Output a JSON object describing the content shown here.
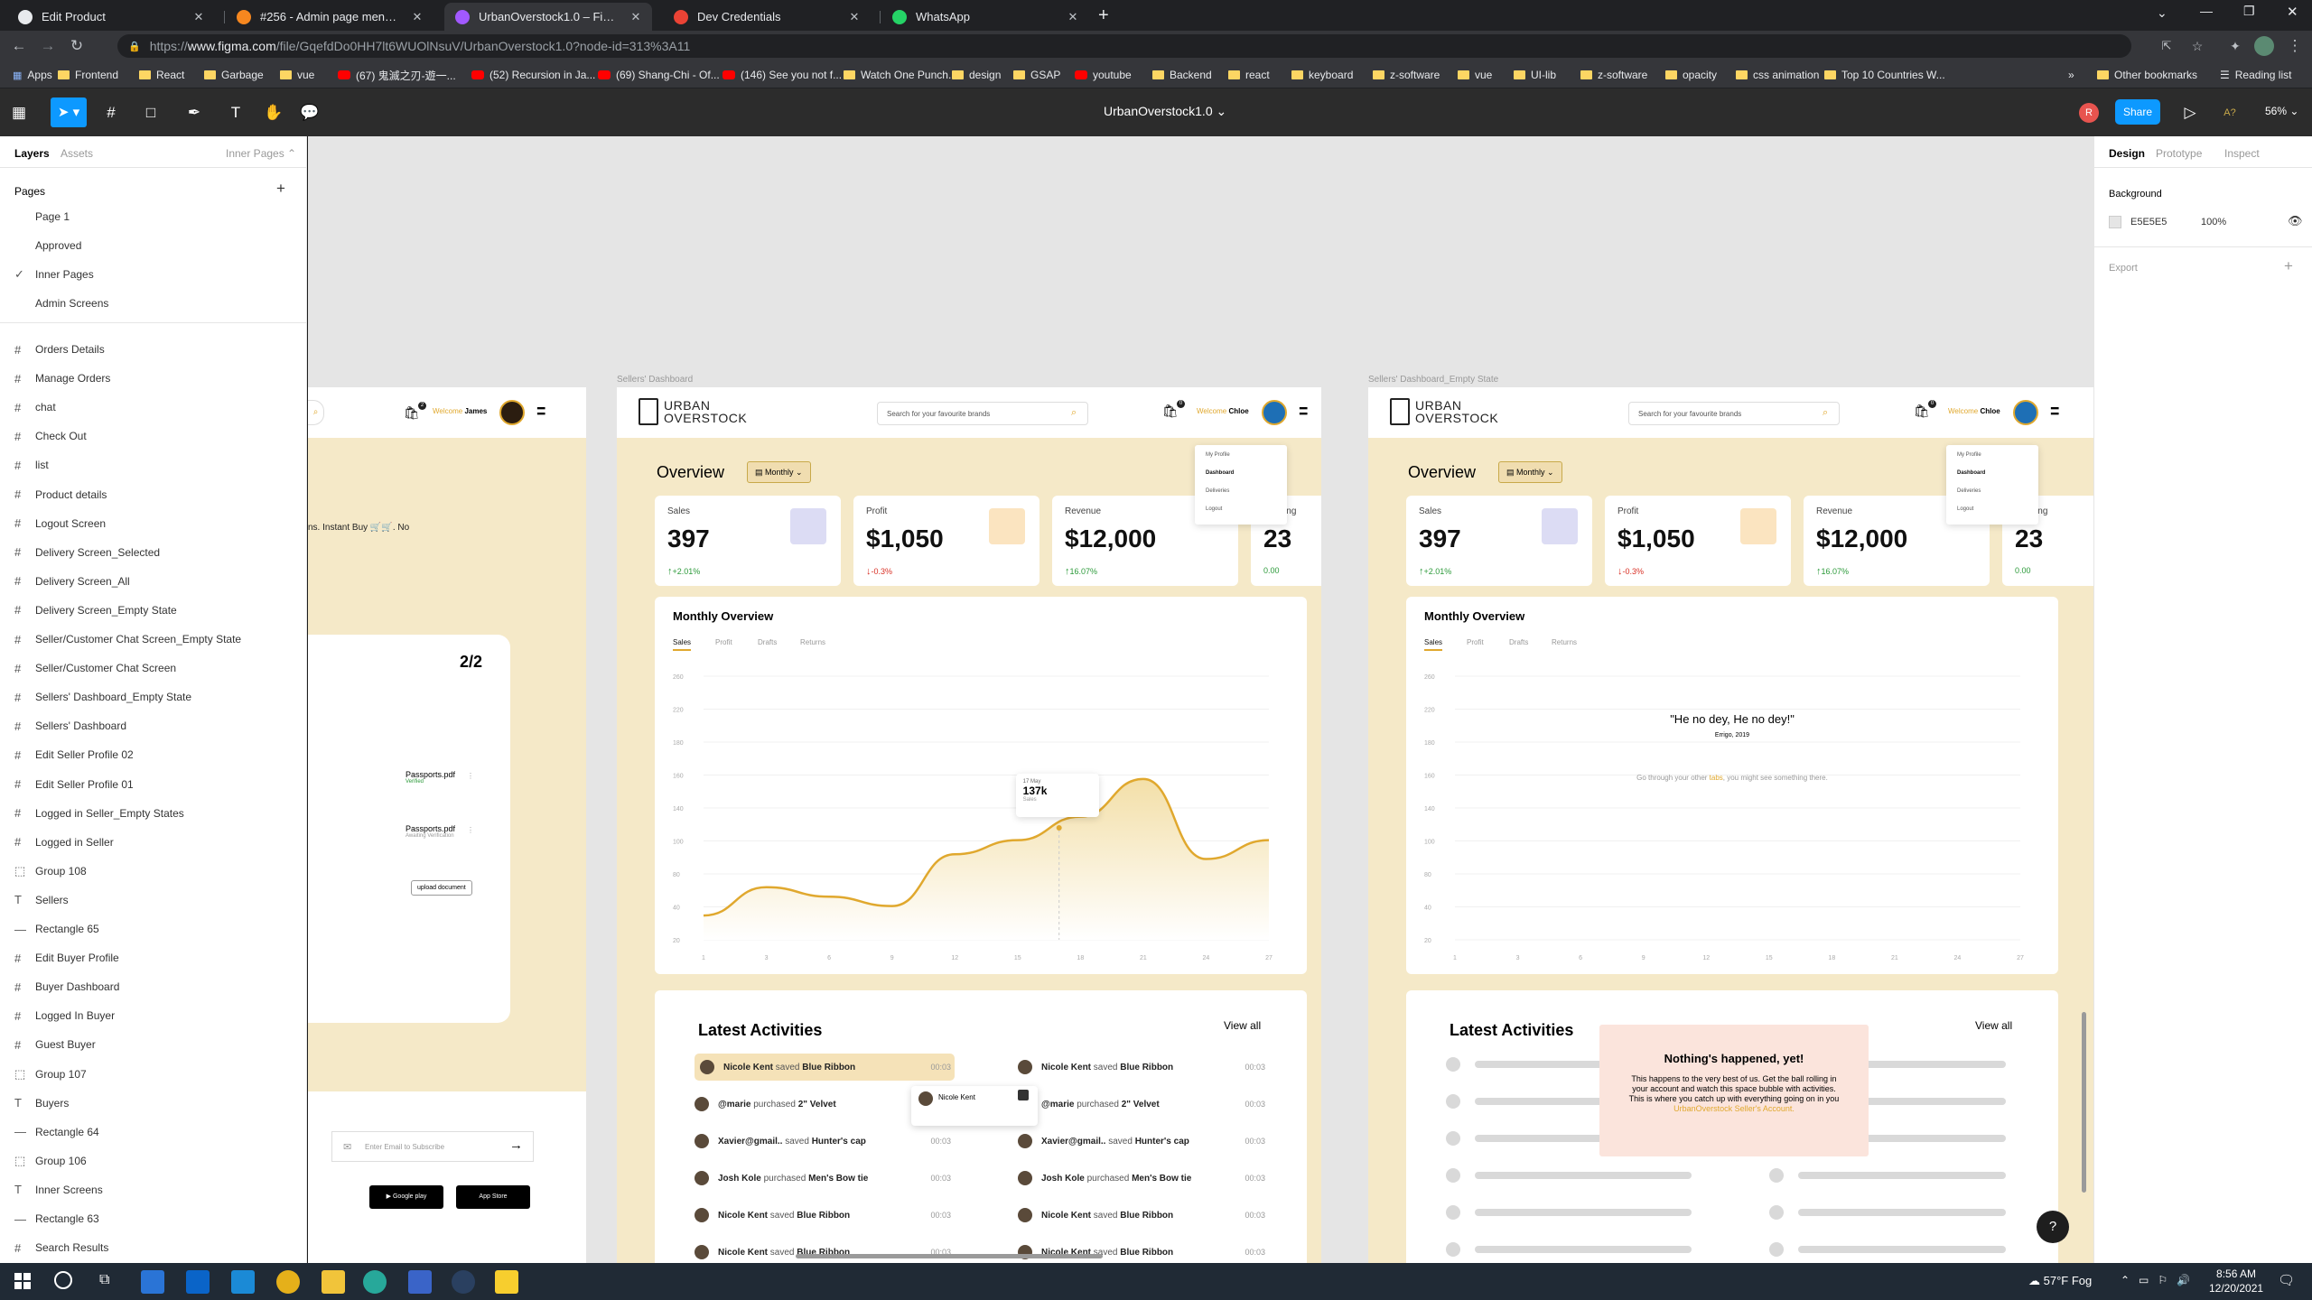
{
  "browser": {
    "tabs": [
      {
        "title": "Edit Product",
        "fav": "#e8eaed"
      },
      {
        "title": "#256 - Admin page menu option",
        "fav": "#f6871f"
      },
      {
        "title": "UrbanOverstock1.0 – Figma",
        "fav": "#a259ff",
        "active": true
      },
      {
        "title": "Dev Credentials",
        "fav": "#ea4335"
      },
      {
        "title": "WhatsApp",
        "fav": "#25d366"
      }
    ],
    "new_tab": "+",
    "url_prefix": "https://",
    "url_host": "www.figma.com",
    "url_rest": "/file/GqefdDo0HH7lt6WUOlNsuV/UrbanOverstock1.0?node-id=313%3A11",
    "bookmarks": [
      "Apps",
      "Frontend",
      "React",
      "Garbage",
      "vue",
      "(67) 鬼滅之刃-遊一...",
      "(52) Recursion in Ja...",
      "(69) Shang-Chi - Of...",
      "(146) See you not f...",
      "Watch One Punch...",
      "design",
      "GSAP",
      "youtube",
      "Backend",
      "react",
      "keyboard",
      "z-software",
      "vue",
      "UI-lib",
      "z-software",
      "opacity",
      "css animation",
      "Top 10 Countries W..."
    ],
    "bookmark_more": "»",
    "other_bookmarks": "Other bookmarks",
    "reading_list": "Reading list"
  },
  "figma": {
    "file_name": "UrbanOverstock1.0",
    "share": "Share",
    "zoom": "56%",
    "user_initial": "R",
    "help": "?",
    "left_tabs": {
      "layers": "Layers",
      "assets": "Assets",
      "page_select": "Inner Pages"
    },
    "pages_header": "Pages",
    "pages": [
      "Page 1",
      "Approved",
      "Inner Pages",
      "Admin Screens"
    ],
    "current_page": "Inner Pages",
    "layers": [
      {
        "name": "Orders Details",
        "icon": "#"
      },
      {
        "name": "Manage Orders",
        "icon": "#"
      },
      {
        "name": "chat",
        "icon": "#"
      },
      {
        "name": "Check Out",
        "icon": "#"
      },
      {
        "name": "list",
        "icon": "#"
      },
      {
        "name": "Product details",
        "icon": "#"
      },
      {
        "name": "Logout Screen",
        "icon": "#"
      },
      {
        "name": "Delivery Screen_Selected",
        "icon": "#"
      },
      {
        "name": "Delivery Screen_All",
        "icon": "#"
      },
      {
        "name": "Delivery Screen_Empty State",
        "icon": "#"
      },
      {
        "name": "Seller/Customer Chat Screen_Empty State",
        "icon": "#"
      },
      {
        "name": "Seller/Customer Chat Screen",
        "icon": "#"
      },
      {
        "name": "Sellers' Dashboard_Empty State",
        "icon": "#"
      },
      {
        "name": "Sellers' Dashboard",
        "icon": "#"
      },
      {
        "name": "Edit Seller Profile 02",
        "icon": "#"
      },
      {
        "name": "Edit Seller Profile 01",
        "icon": "#"
      },
      {
        "name": "Logged in Seller_Empty States",
        "icon": "#"
      },
      {
        "name": "Logged in Seller",
        "icon": "#"
      },
      {
        "name": "Group 108",
        "icon": "⬚"
      },
      {
        "name": "Sellers",
        "icon": "T"
      },
      {
        "name": "Rectangle 65",
        "icon": "—"
      },
      {
        "name": "Edit Buyer Profile",
        "icon": "#"
      },
      {
        "name": "Buyer Dashboard",
        "icon": "#"
      },
      {
        "name": "Logged In Buyer",
        "icon": "#"
      },
      {
        "name": "Guest Buyer",
        "icon": "#"
      },
      {
        "name": "Group 107",
        "icon": "⬚"
      },
      {
        "name": "Buyers",
        "icon": "T"
      },
      {
        "name": "Rectangle 64",
        "icon": "—"
      },
      {
        "name": "Group 106",
        "icon": "⬚"
      },
      {
        "name": "Inner Screens",
        "icon": "T"
      },
      {
        "name": "Rectangle 63",
        "icon": "—"
      },
      {
        "name": "Search Results",
        "icon": "#"
      }
    ],
    "right_tabs": {
      "design": "Design",
      "prototype": "Prototype",
      "inspect": "Inspect"
    },
    "background_label": "Background",
    "background_hex": "E5E5E5",
    "background_opacity": "100%",
    "export_label": "Export"
  },
  "frames": {
    "left_partial": {
      "welcome": "Welcome",
      "user": "James",
      "cart_count": "2",
      "text_fragment": "ns. Instant Buy 🛒🛒. No",
      "counter": "2/2",
      "files": [
        {
          "name": "Passports.pdf",
          "status": "Verified"
        },
        {
          "name": "Passports.pdf",
          "status": "Awaiting Verification"
        }
      ],
      "upload_btn": "upload document",
      "email_placeholder": "Enter Email to Subscribe",
      "google_play": "Google play",
      "app_store": "App Store"
    },
    "dashboard": {
      "label": "Sellers' Dashboard",
      "brand_line1": "URBAN",
      "brand_line2": "OVERSTOCK",
      "search_placeholder": "Search for your favourite brands",
      "welcome": "Welcome",
      "user": "Chloe",
      "cart_count": "0",
      "menu": [
        "My Profile",
        "Dashboard",
        "Deliveries",
        "Logout"
      ],
      "overview": "Overview",
      "period": "Monthly",
      "stats": [
        {
          "label": "Sales",
          "value": "397",
          "change": "+2.01%",
          "dir": "up"
        },
        {
          "label": "Profit",
          "value": "$1,050",
          "change": "-0.3%",
          "dir": "down"
        },
        {
          "label": "Revenue",
          "value": "$12,000",
          "change": "16.07%",
          "dir": "up"
        },
        {
          "label": "Pending Shipping",
          "value": "23",
          "change": "0.00",
          "dir": "none"
        }
      ],
      "monthly_overview": "Monthly Overview",
      "chart_tabs": [
        "Sales",
        "Profit",
        "Drafts",
        "Returns"
      ],
      "tooltip": {
        "date": "17 May",
        "value": "137k",
        "label": "Sales"
      },
      "latest_activities": "Latest Activities",
      "view_all": "View all",
      "activities_left": [
        {
          "name": "Nicole Kent",
          "verb": "saved",
          "item": "Blue Ribbon",
          "time": "00:03"
        },
        {
          "name": "@marie",
          "verb": "purchased",
          "item": "2\" Velvet",
          "time": "00:03"
        },
        {
          "name": "Xavier@gmail..",
          "verb": "saved",
          "item": "Hunter's cap",
          "time": "00:03"
        },
        {
          "name": "Josh Kole",
          "verb": "purchased",
          "item": "Men's Bow tie",
          "time": "00:03"
        },
        {
          "name": "Nicole Kent",
          "verb": "saved",
          "item": "Blue Ribbon",
          "time": "00:03"
        },
        {
          "name": "Nicole Kent",
          "verb": "saved",
          "item": "Blue Ribbon",
          "time": "00:03"
        }
      ],
      "activities_right": [
        {
          "name": "Nicole Kent",
          "verb": "saved",
          "item": "Blue Ribbon",
          "time": "00:03"
        },
        {
          "name": "@marie",
          "verb": "purchased",
          "item": "2\" Velvet",
          "time": "00:03"
        },
        {
          "name": "Xavier@gmail..",
          "verb": "saved",
          "item": "Hunter's cap",
          "time": "00:03"
        },
        {
          "name": "Josh Kole",
          "verb": "purchased",
          "item": "Men's Bow tie",
          "time": "00:03"
        },
        {
          "name": "Nicole Kent",
          "verb": "saved",
          "item": "Blue Ribbon",
          "time": "00:03"
        },
        {
          "name": "Nicole Kent",
          "verb": "saved",
          "item": "Blue Ribbon",
          "time": "00:03"
        }
      ],
      "popup_name": "Nicole Kent"
    },
    "empty": {
      "label": "Sellers' Dashboard_Empty State",
      "quote": "\"He no dey, He no dey!\"",
      "quote_src": "Errigo, 2019",
      "hint_pre": "Go through your other ",
      "hint_link": "tabs",
      "hint_post": ", you might see something there.",
      "nothing_title": "Nothing's happened, yet!",
      "nothing_body": "This happens to the very best of us. Get the ball rolling in your account and watch this space bubble with activities. This is where you catch up with everything going on in you ",
      "nothing_link": "UrbanOverstock Seller's Account."
    }
  },
  "chart_data": {
    "type": "area",
    "x": [
      1,
      3,
      6,
      9,
      12,
      15,
      18,
      21,
      24,
      27
    ],
    "series": [
      {
        "values": [
          45,
          75,
          65,
          55,
          110,
          125,
          150,
          190,
          105,
          125
        ]
      }
    ],
    "y_ticks": [
      20,
      40,
      80,
      100,
      140,
      160,
      180,
      220,
      260
    ],
    "ylim": [
      0,
      280
    ],
    "color": "#e0a82e",
    "highlight": {
      "x": 17,
      "value": "137k"
    }
  },
  "taskbar": {
    "weather": "57°F Fog",
    "time": "8:56 AM",
    "date": "12/20/2021"
  }
}
